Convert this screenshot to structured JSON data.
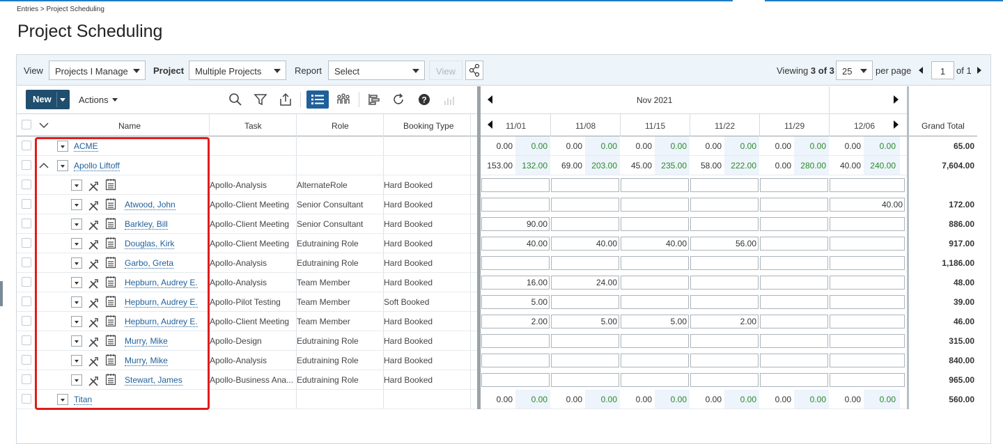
{
  "breadcrumb": "Entries > Project Scheduling",
  "page_title": "Project Scheduling",
  "filters": {
    "view_label": "View",
    "view_value": "Projects I Manage",
    "project_label": "Project",
    "project_value": "Multiple Projects",
    "report_label": "Report",
    "report_value": "Select",
    "view_button": "View"
  },
  "paging": {
    "viewing_prefix": "Viewing",
    "viewing_count": "3 of 3",
    "per_page_value": "25",
    "per_page_label": "per page",
    "page_number": "1",
    "of_pages": "of 1"
  },
  "toolbar": {
    "new_label": "New",
    "actions_label": "Actions"
  },
  "columns": {
    "name": "Name",
    "task": "Task",
    "role": "Role",
    "booking_type": "Booking Type",
    "grand_total": "Grand Total"
  },
  "timeline": {
    "month": "Nov 2021",
    "weeks": [
      "11/01",
      "11/08",
      "11/15",
      "11/22",
      "11/29",
      "12/06"
    ]
  },
  "projects": {
    "acme": {
      "name": "ACME",
      "summary": [
        "0.00",
        "0.00",
        "0.00",
        "0.00",
        "0.00",
        "0.00",
        "0.00",
        "0.00",
        "0.00",
        "0.00",
        "0.00",
        "0.00"
      ],
      "grand_total": "65.00"
    },
    "apollo": {
      "name": "Apollo Liftoff",
      "summary": [
        "153.00",
        "132.00",
        "69.00",
        "203.00",
        "45.00",
        "235.00",
        "58.00",
        "222.00",
        "0.00",
        "280.00",
        "40.00",
        "240.00"
      ],
      "grand_total": "7,604.00"
    },
    "titan": {
      "name": "Titan",
      "summary": [
        "0.00",
        "0.00",
        "0.00",
        "0.00",
        "0.00",
        "0.00",
        "0.00",
        "0.00",
        "0.00",
        "0.00",
        "0.00",
        "0.00"
      ],
      "grand_total": "560.00"
    }
  },
  "assignments": [
    {
      "name": "",
      "task": "Apollo-Analysis",
      "role": "AlternateRole",
      "booking": "Hard Booked",
      "weeks": [
        "",
        "",
        "",
        "",
        "",
        ""
      ],
      "total": ""
    },
    {
      "name": "Atwood, John",
      "task": "Apollo-Client Meeting",
      "role": "Senior Consultant",
      "booking": "Hard Booked",
      "weeks": [
        "",
        "",
        "",
        "",
        "",
        "40.00"
      ],
      "total": "172.00"
    },
    {
      "name": "Barkley, Bill",
      "task": "Apollo-Client Meeting",
      "role": "Senior Consultant",
      "booking": "Hard Booked",
      "weeks": [
        "90.00",
        "",
        "",
        "",
        "",
        ""
      ],
      "total": "886.00"
    },
    {
      "name": "Douglas, Kirk",
      "task": "Apollo-Client Meeting",
      "role": "Edutraining Role",
      "booking": "Hard Booked",
      "weeks": [
        "40.00",
        "40.00",
        "40.00",
        "56.00",
        "",
        ""
      ],
      "total": "917.00"
    },
    {
      "name": "Garbo, Greta",
      "task": "Apollo-Analysis",
      "role": "Edutraining Role",
      "booking": "Hard Booked",
      "weeks": [
        "",
        "",
        "",
        "",
        "",
        ""
      ],
      "total": "1,186.00"
    },
    {
      "name": "Hepburn, Audrey E.",
      "task": "Apollo-Analysis",
      "role": "Team Member",
      "booking": "Hard Booked",
      "weeks": [
        "16.00",
        "24.00",
        "",
        "",
        "",
        ""
      ],
      "total": "48.00"
    },
    {
      "name": "Hepburn, Audrey E.",
      "task": "Apollo-Pilot Testing",
      "role": "Team Member",
      "booking": "Soft Booked",
      "weeks": [
        "5.00",
        "",
        "",
        "",
        "",
        ""
      ],
      "total": "39.00"
    },
    {
      "name": "Hepburn, Audrey E.",
      "task": "Apollo-Client Meeting",
      "role": "Team Member",
      "booking": "Hard Booked",
      "weeks": [
        "2.00",
        "5.00",
        "5.00",
        "2.00",
        "",
        ""
      ],
      "total": "46.00"
    },
    {
      "name": "Murry, Mike",
      "task": "Apollo-Design",
      "role": "Edutraining Role",
      "booking": "Hard Booked",
      "weeks": [
        "",
        "",
        "",
        "",
        "",
        ""
      ],
      "total": "315.00"
    },
    {
      "name": "Murry, Mike",
      "task": "Apollo-Analysis",
      "role": "Edutraining Role",
      "booking": "Hard Booked",
      "weeks": [
        "",
        "",
        "",
        "",
        "",
        ""
      ],
      "total": "840.00"
    },
    {
      "name": "Stewart, James",
      "task": "Apollo-Business Ana...",
      "role": "Edutraining Role",
      "booking": "Hard Booked",
      "weeks": [
        "",
        "",
        "",
        "",
        "",
        ""
      ],
      "total": "965.00"
    }
  ],
  "colors": {
    "accent": "#1f4e6e",
    "link": "#1f5f9a",
    "green_value": "#2a8a2a",
    "highlight_box": "#e01b1b"
  }
}
